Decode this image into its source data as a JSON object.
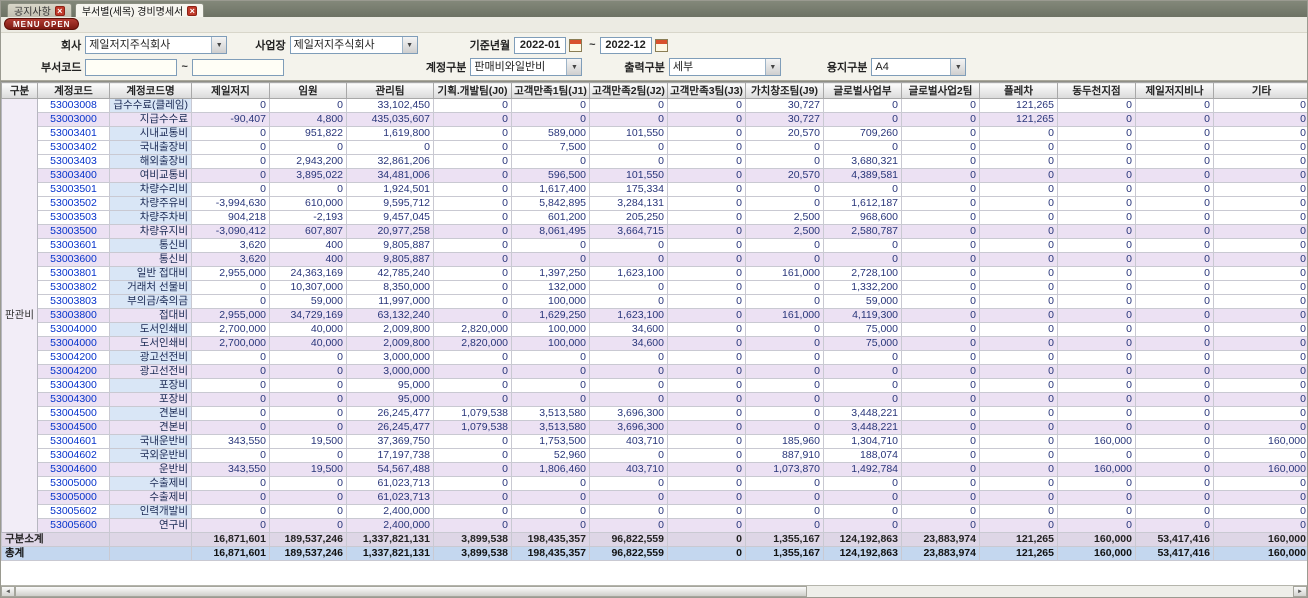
{
  "tabs": [
    {
      "label": "공지사항"
    },
    {
      "label": "부서별(세목) 경비명세서"
    }
  ],
  "menu_open_label": "MENU OPEN",
  "icons": {
    "close": "×",
    "dropdown": "▼",
    "scroll_left": "◄",
    "scroll_right": "►"
  },
  "filters": {
    "company_label": "회사",
    "company_value": "제일저지주식회사",
    "workplace_label": "사업장",
    "workplace_value": "제일저지주식회사",
    "period_label": "기준년월",
    "period_from": "2022-01",
    "period_to": "2022-12",
    "tilde": "~",
    "dept_code_label": "부서코드",
    "account_type_label": "계정구분",
    "account_type_value": "판매비와일반비",
    "output_type_label": "출력구분",
    "output_type_value": "세부",
    "paper_label": "용지구분",
    "paper_value": "A4"
  },
  "table": {
    "group_label": "판관비",
    "columns": [
      "구분",
      "계정코드",
      "계정코드명",
      "제일저지",
      "임원",
      "관리팀",
      "기획.개발팀(J0)",
      "고객만족1팀(J1)",
      "고객만족2팀(J2)",
      "고객만족3팀(J3)",
      "가치창조팀(J9)",
      "글로벌사업부",
      "글로벌사업2팀",
      "플레차",
      "동두천지점",
      "제일저지비나",
      "기타"
    ],
    "rows": [
      {
        "code": "53003008",
        "name": "급수수료(클레임)",
        "subtotal": false,
        "values": [
          "0",
          "0",
          "33,102,450",
          "0",
          "0",
          "0",
          "0",
          "30,727",
          "0",
          "0",
          "121,265",
          "0",
          "0",
          "0"
        ]
      },
      {
        "code": "53003000",
        "name": "지급수수료",
        "subtotal": true,
        "values": [
          "-90,407",
          "4,800",
          "435,035,607",
          "0",
          "0",
          "0",
          "0",
          "30,727",
          "0",
          "0",
          "121,265",
          "0",
          "0",
          "0"
        ]
      },
      {
        "code": "53003401",
        "name": "시내교통비",
        "subtotal": false,
        "values": [
          "0",
          "951,822",
          "1,619,800",
          "0",
          "589,000",
          "101,550",
          "0",
          "20,570",
          "709,260",
          "0",
          "0",
          "0",
          "0",
          "0"
        ]
      },
      {
        "code": "53003402",
        "name": "국내출장비",
        "subtotal": false,
        "values": [
          "0",
          "0",
          "0",
          "0",
          "7,500",
          "0",
          "0",
          "0",
          "0",
          "0",
          "0",
          "0",
          "0",
          "0"
        ]
      },
      {
        "code": "53003403",
        "name": "해외출장비",
        "subtotal": false,
        "values": [
          "0",
          "2,943,200",
          "32,861,206",
          "0",
          "0",
          "0",
          "0",
          "0",
          "3,680,321",
          "0",
          "0",
          "0",
          "0",
          "0"
        ]
      },
      {
        "code": "53003400",
        "name": "여비교통비",
        "subtotal": true,
        "values": [
          "0",
          "3,895,022",
          "34,481,006",
          "0",
          "596,500",
          "101,550",
          "0",
          "20,570",
          "4,389,581",
          "0",
          "0",
          "0",
          "0",
          "0"
        ]
      },
      {
        "code": "53003501",
        "name": "차량수리비",
        "subtotal": false,
        "values": [
          "0",
          "0",
          "1,924,501",
          "0",
          "1,617,400",
          "175,334",
          "0",
          "0",
          "0",
          "0",
          "0",
          "0",
          "0",
          "0"
        ]
      },
      {
        "code": "53003502",
        "name": "차량주유비",
        "subtotal": false,
        "values": [
          "-3,994,630",
          "610,000",
          "9,595,712",
          "0",
          "5,842,895",
          "3,284,131",
          "0",
          "0",
          "1,612,187",
          "0",
          "0",
          "0",
          "0",
          "0"
        ]
      },
      {
        "code": "53003503",
        "name": "차량주차비",
        "subtotal": false,
        "values": [
          "904,218",
          "-2,193",
          "9,457,045",
          "0",
          "601,200",
          "205,250",
          "0",
          "2,500",
          "968,600",
          "0",
          "0",
          "0",
          "0",
          "0"
        ]
      },
      {
        "code": "53003500",
        "name": "차량유지비",
        "subtotal": true,
        "values": [
          "-3,090,412",
          "607,807",
          "20,977,258",
          "0",
          "8,061,495",
          "3,664,715",
          "0",
          "2,500",
          "2,580,787",
          "0",
          "0",
          "0",
          "0",
          "0"
        ]
      },
      {
        "code": "53003601",
        "name": "통신비",
        "subtotal": false,
        "values": [
          "3,620",
          "400",
          "9,805,887",
          "0",
          "0",
          "0",
          "0",
          "0",
          "0",
          "0",
          "0",
          "0",
          "0",
          "0"
        ]
      },
      {
        "code": "53003600",
        "name": "통신비",
        "subtotal": true,
        "values": [
          "3,620",
          "400",
          "9,805,887",
          "0",
          "0",
          "0",
          "0",
          "0",
          "0",
          "0",
          "0",
          "0",
          "0",
          "0"
        ]
      },
      {
        "code": "53003801",
        "name": "일반 접대비",
        "subtotal": false,
        "values": [
          "2,955,000",
          "24,363,169",
          "42,785,240",
          "0",
          "1,397,250",
          "1,623,100",
          "0",
          "161,000",
          "2,728,100",
          "0",
          "0",
          "0",
          "0",
          "0"
        ]
      },
      {
        "code": "53003802",
        "name": "거래처 선물비",
        "subtotal": false,
        "values": [
          "0",
          "10,307,000",
          "8,350,000",
          "0",
          "132,000",
          "0",
          "0",
          "0",
          "1,332,200",
          "0",
          "0",
          "0",
          "0",
          "0"
        ]
      },
      {
        "code": "53003803",
        "name": "부의금/축의금",
        "subtotal": false,
        "values": [
          "0",
          "59,000",
          "11,997,000",
          "0",
          "100,000",
          "0",
          "0",
          "0",
          "59,000",
          "0",
          "0",
          "0",
          "0",
          "0"
        ]
      },
      {
        "code": "53003800",
        "name": "접대비",
        "subtotal": true,
        "values": [
          "2,955,000",
          "34,729,169",
          "63,132,240",
          "0",
          "1,629,250",
          "1,623,100",
          "0",
          "161,000",
          "4,119,300",
          "0",
          "0",
          "0",
          "0",
          "0"
        ]
      },
      {
        "code": "53004000",
        "name": "도서인쇄비",
        "subtotal": false,
        "values": [
          "2,700,000",
          "40,000",
          "2,009,800",
          "2,820,000",
          "100,000",
          "34,600",
          "0",
          "0",
          "75,000",
          "0",
          "0",
          "0",
          "0",
          "0"
        ]
      },
      {
        "code": "53004000",
        "name": "도서인쇄비",
        "subtotal": true,
        "values": [
          "2,700,000",
          "40,000",
          "2,009,800",
          "2,820,000",
          "100,000",
          "34,600",
          "0",
          "0",
          "75,000",
          "0",
          "0",
          "0",
          "0",
          "0"
        ]
      },
      {
        "code": "53004200",
        "name": "광고선전비",
        "subtotal": false,
        "values": [
          "0",
          "0",
          "3,000,000",
          "0",
          "0",
          "0",
          "0",
          "0",
          "0",
          "0",
          "0",
          "0",
          "0",
          "0"
        ]
      },
      {
        "code": "53004200",
        "name": "광고선전비",
        "subtotal": true,
        "values": [
          "0",
          "0",
          "3,000,000",
          "0",
          "0",
          "0",
          "0",
          "0",
          "0",
          "0",
          "0",
          "0",
          "0",
          "0"
        ]
      },
      {
        "code": "53004300",
        "name": "포장비",
        "subtotal": false,
        "values": [
          "0",
          "0",
          "95,000",
          "0",
          "0",
          "0",
          "0",
          "0",
          "0",
          "0",
          "0",
          "0",
          "0",
          "0"
        ]
      },
      {
        "code": "53004300",
        "name": "포장비",
        "subtotal": true,
        "values": [
          "0",
          "0",
          "95,000",
          "0",
          "0",
          "0",
          "0",
          "0",
          "0",
          "0",
          "0",
          "0",
          "0",
          "0"
        ]
      },
      {
        "code": "53004500",
        "name": "견본비",
        "subtotal": false,
        "values": [
          "0",
          "0",
          "26,245,477",
          "1,079,538",
          "3,513,580",
          "3,696,300",
          "0",
          "0",
          "3,448,221",
          "0",
          "0",
          "0",
          "0",
          "0"
        ]
      },
      {
        "code": "53004500",
        "name": "견본비",
        "subtotal": true,
        "values": [
          "0",
          "0",
          "26,245,477",
          "1,079,538",
          "3,513,580",
          "3,696,300",
          "0",
          "0",
          "3,448,221",
          "0",
          "0",
          "0",
          "0",
          "0"
        ]
      },
      {
        "code": "53004601",
        "name": "국내운반비",
        "subtotal": false,
        "values": [
          "343,550",
          "19,500",
          "37,369,750",
          "0",
          "1,753,500",
          "403,710",
          "0",
          "185,960",
          "1,304,710",
          "0",
          "0",
          "160,000",
          "0",
          "160,000"
        ]
      },
      {
        "code": "53004602",
        "name": "국외운반비",
        "subtotal": false,
        "values": [
          "0",
          "0",
          "17,197,738",
          "0",
          "52,960",
          "0",
          "0",
          "887,910",
          "188,074",
          "0",
          "0",
          "0",
          "0",
          "0"
        ]
      },
      {
        "code": "53004600",
        "name": "운반비",
        "subtotal": true,
        "values": [
          "343,550",
          "19,500",
          "54,567,488",
          "0",
          "1,806,460",
          "403,710",
          "0",
          "1,073,870",
          "1,492,784",
          "0",
          "0",
          "160,000",
          "0",
          "160,000"
        ]
      },
      {
        "code": "53005000",
        "name": "수출제비",
        "subtotal": false,
        "values": [
          "0",
          "0",
          "61,023,713",
          "0",
          "0",
          "0",
          "0",
          "0",
          "0",
          "0",
          "0",
          "0",
          "0",
          "0"
        ]
      },
      {
        "code": "53005000",
        "name": "수출제비",
        "subtotal": true,
        "values": [
          "0",
          "0",
          "61,023,713",
          "0",
          "0",
          "0",
          "0",
          "0",
          "0",
          "0",
          "0",
          "0",
          "0",
          "0"
        ]
      },
      {
        "code": "53005602",
        "name": "인력개발비",
        "subtotal": false,
        "values": [
          "0",
          "0",
          "2,400,000",
          "0",
          "0",
          "0",
          "0",
          "0",
          "0",
          "0",
          "0",
          "0",
          "0",
          "0"
        ]
      },
      {
        "code": "53005600",
        "name": "연구비",
        "subtotal": true,
        "values": [
          "0",
          "0",
          "2,400,000",
          "0",
          "0",
          "0",
          "0",
          "0",
          "0",
          "0",
          "0",
          "0",
          "0",
          "0"
        ]
      }
    ],
    "footer": [
      {
        "label": "구분소계",
        "values": [
          "16,871,601",
          "189,537,246",
          "1,337,821,131",
          "3,899,538",
          "198,435,357",
          "96,822,559",
          "0",
          "1,355,167",
          "124,192,863",
          "23,883,974",
          "121,265",
          "160,000",
          "53,417,416",
          "160,000"
        ]
      },
      {
        "label": "총계",
        "values": [
          "16,871,601",
          "189,537,246",
          "1,337,821,131",
          "3,899,538",
          "198,435,357",
          "96,822,559",
          "0",
          "1,355,167",
          "124,192,863",
          "23,883,974",
          "121,265",
          "160,000",
          "53,417,416",
          "160,000"
        ]
      }
    ]
  }
}
